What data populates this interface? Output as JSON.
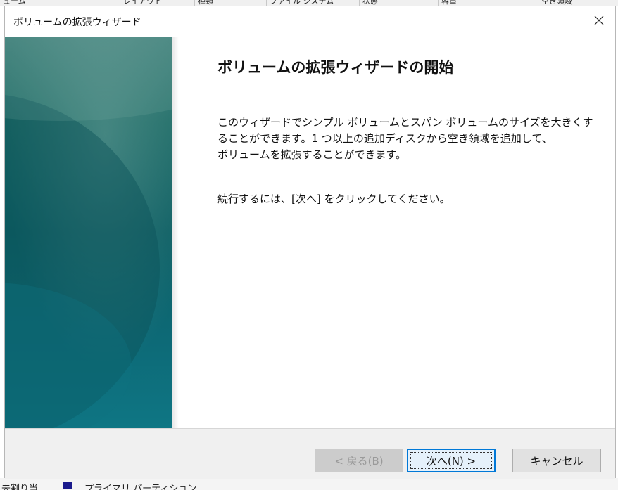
{
  "background": {
    "header_columns": [
      "ューム",
      "レイアウト",
      "種類",
      "ファイル システム",
      "状態",
      "容量",
      "空き領域"
    ],
    "bottom_fragment": "未割り当",
    "bottom_fragment2": "プライマリ パーティション"
  },
  "dialog": {
    "title": "ボリュームの拡張ウィザード",
    "heading": "ボリュームの拡張ウィザードの開始",
    "paragraph_lines": [
      "このウィザードでシンプル ボリュームとスパン ボリュームのサイズを大きくす",
      "ることができます。1 つ以上の追加ディスクから空き領域を追加して、",
      "ボリュームを拡張することができます。"
    ],
    "hint": "続行するには、[次へ] をクリックしてください。"
  },
  "buttons": {
    "back_label": "< 戻る(B)",
    "next_label": "次へ(N) >",
    "cancel_label": "キャンセル"
  },
  "colors": {
    "sidebar_top": "#3f7f7a",
    "sidebar_bottom": "#0e7684",
    "default_button_border": "#0078d7"
  },
  "icons": {
    "close": "close-icon"
  }
}
